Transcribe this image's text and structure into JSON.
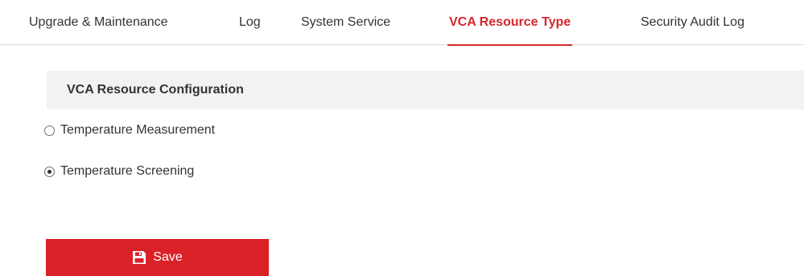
{
  "tabs": [
    {
      "label": "Upgrade & Maintenance",
      "active": false
    },
    {
      "label": "Log",
      "active": false
    },
    {
      "label": "System Service",
      "active": false
    },
    {
      "label": "VCA Resource Type",
      "active": true
    },
    {
      "label": "Security Audit Log",
      "active": false
    }
  ],
  "section": {
    "title": "VCA Resource Configuration"
  },
  "options": [
    {
      "label": "Temperature Measurement",
      "checked": false
    },
    {
      "label": "Temperature Screening",
      "checked": true
    }
  ],
  "save_button": {
    "label": "Save",
    "icon": "save-icon"
  },
  "colors": {
    "accent": "#d4272d",
    "button": "#da2128",
    "section_bg": "#f2f2f2"
  }
}
